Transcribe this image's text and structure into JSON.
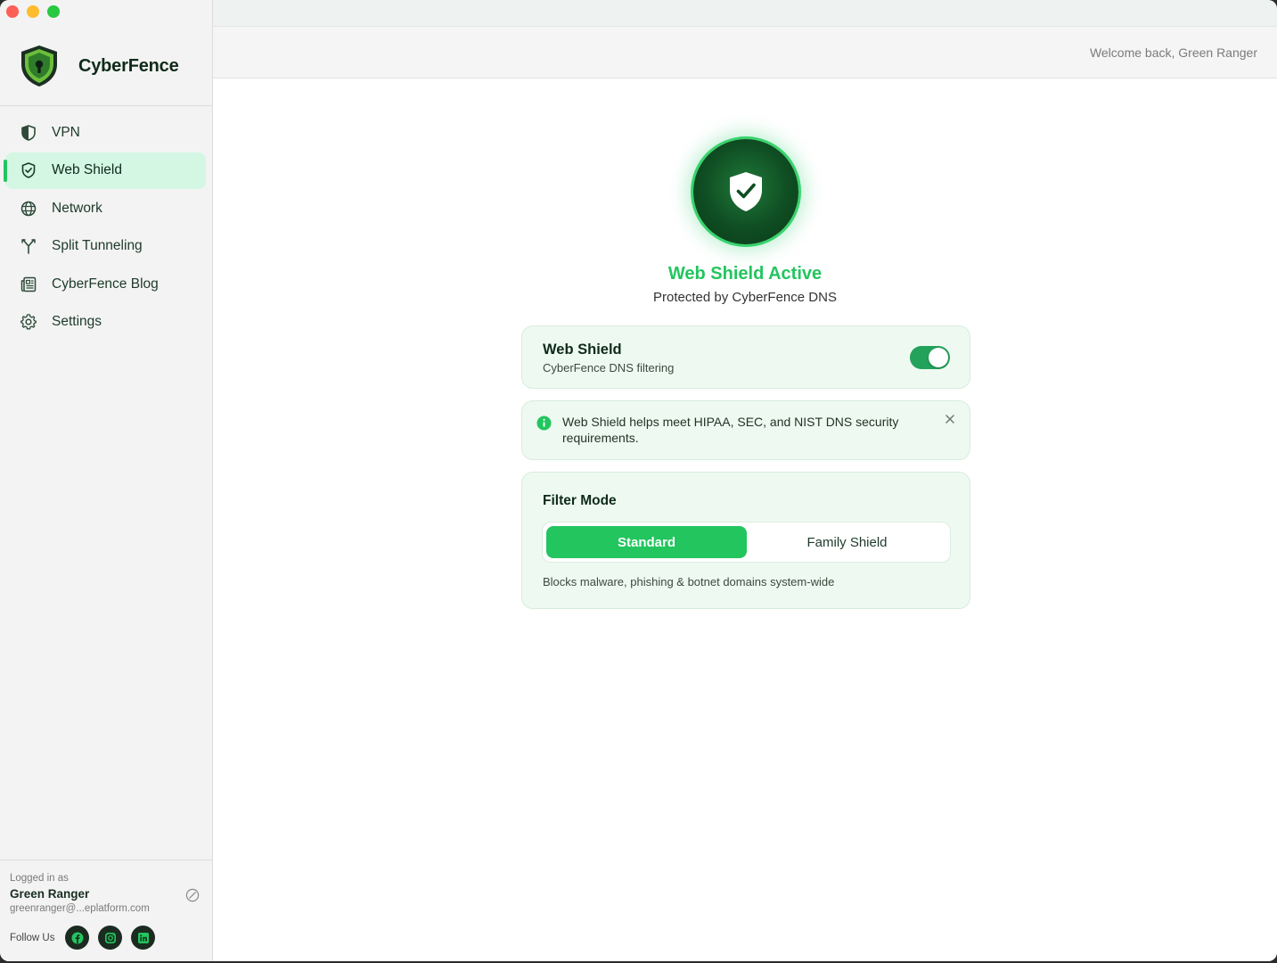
{
  "app": {
    "name": "CyberFence"
  },
  "sidebar": {
    "items": [
      {
        "label": "VPN",
        "icon": "half-shield-icon",
        "active": false
      },
      {
        "label": "Web Shield",
        "icon": "shield-check-icon",
        "active": true
      },
      {
        "label": "Network",
        "icon": "globe-icon",
        "active": false
      },
      {
        "label": "Split Tunneling",
        "icon": "split-arrow-icon",
        "active": false
      },
      {
        "label": "CyberFence Blog",
        "icon": "newspaper-icon",
        "active": false
      },
      {
        "label": "Settings",
        "icon": "gear-icon",
        "active": false
      }
    ],
    "user": {
      "logged_in_label": "Logged in as",
      "name": "Green Ranger",
      "email": "greenranger@...eplatform.com"
    },
    "follow_label": "Follow Us",
    "socials": [
      "facebook-icon",
      "instagram-icon",
      "linkedin-icon"
    ]
  },
  "header": {
    "welcome": "Welcome back, Green Ranger"
  },
  "status": {
    "title": "Web Shield Active",
    "subtitle": "Protected by CyberFence DNS"
  },
  "web_shield_card": {
    "title": "Web Shield",
    "subtitle": "CyberFence DNS filtering",
    "enabled": true
  },
  "info_banner": {
    "text": "Web Shield helps meet HIPAA, SEC, and NIST DNS security requirements."
  },
  "filter_mode": {
    "title": "Filter Mode",
    "options": [
      "Standard",
      "Family Shield"
    ],
    "selected": "Standard",
    "description": "Blocks malware, phishing & botnet domains system-wide"
  },
  "colors": {
    "accent": "#22c55e",
    "active_nav_bg": "#d4f7e3",
    "card_bg": "#eefaf1",
    "brand_dark": "#0f2a1a"
  }
}
